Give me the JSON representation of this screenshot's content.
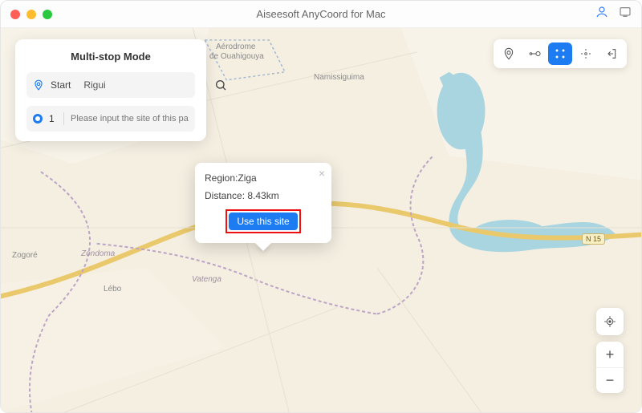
{
  "titlebar": {
    "title": "Aiseesoft AnyCoord for Mac"
  },
  "panel": {
    "title": "Multi-stop Mode",
    "start_label": "Start",
    "start_value": "Rigui",
    "stop": {
      "number": "1",
      "placeholder": "Please input the site of this path"
    }
  },
  "popup": {
    "region_label": "Region:",
    "region_value": "Ziga",
    "distance_label": "Distance:",
    "distance_value": "8.43km",
    "cta_label": "Use this site"
  },
  "map": {
    "labels": {
      "namissiguima": "Namissiguima",
      "aerodrome1": "Aérodrome",
      "aerodrome2": "de Ouahigouya",
      "zogore": "Zogoré",
      "zondoma": "Zondoma",
      "lebo": "Lébo",
      "vatenga": "Vatenga",
      "road_n15": "N 15"
    }
  },
  "zoom": {
    "in": "+",
    "out": "−"
  }
}
